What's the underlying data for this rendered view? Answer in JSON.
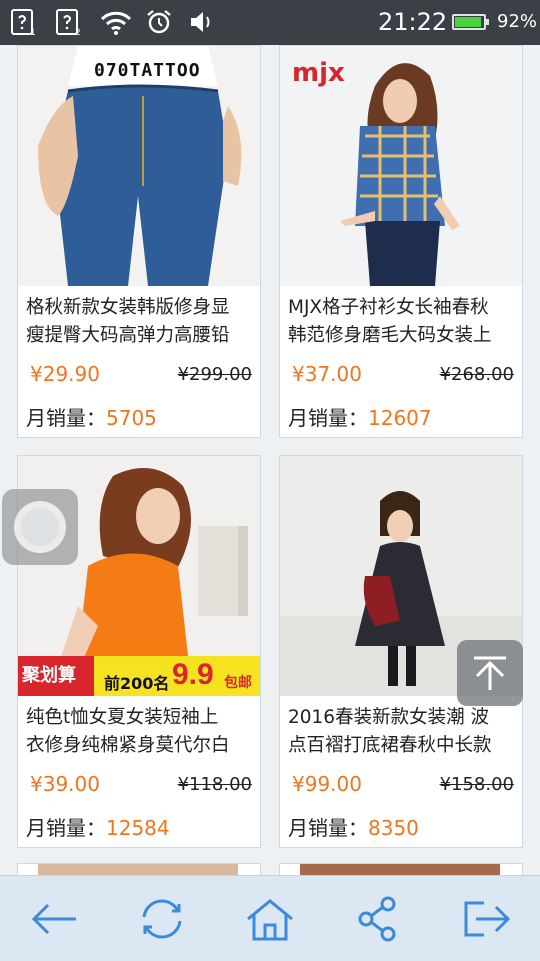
{
  "status_bar": {
    "time": "21:22",
    "battery_percent": "92%",
    "battery_level": 0.92,
    "icons": [
      "sim1-question-icon",
      "sim2-question-icon",
      "wifi-icon",
      "alarm-icon",
      "volume-icon"
    ]
  },
  "products": [
    {
      "title_line1": "格秋新款女装韩版修身显",
      "title_line2": "瘦提臀大码高弹力高腰铅",
      "price": "¥29.90",
      "original_price": "¥299.00",
      "sales_label": "月销量：",
      "sales": "5705",
      "image_text": "070TATTOO"
    },
    {
      "title_line1": "MJX格子衬衫女长袖春秋",
      "title_line2": "韩范修身磨毛大码女装上",
      "price": "¥37.00",
      "original_price": "¥268.00",
      "sales_label": "月销量：",
      "sales": "12607",
      "image_text": "mjx"
    },
    {
      "title_line1": "纯色t恤女夏女装短袖上",
      "title_line2": "衣修身纯棉紧身莫代尔白",
      "price": "¥39.00",
      "original_price": "¥118.00",
      "sales_label": "月销量：",
      "sales": "12584",
      "banner_left": "聚划算",
      "banner_top": "前200名",
      "banner_price": "9.9",
      "banner_suffix": "包邮"
    },
    {
      "title_line1": "2016春装新款女装潮 波",
      "title_line2": "点百褶打底裙春秋中长款",
      "price": "¥99.00",
      "original_price": "¥158.00",
      "sales_label": "月销量：",
      "sales": "8350"
    }
  ],
  "bottom_nav": [
    "back-arrow-icon",
    "refresh-icon",
    "home-icon",
    "share-icon",
    "exit-icon"
  ],
  "colors": {
    "accent_orange": "#ef7520",
    "nav_icon_blue": "#3d8ad8",
    "status_bar_bg": "#3a4045",
    "bottom_bar_bg": "#dbe8f4"
  }
}
